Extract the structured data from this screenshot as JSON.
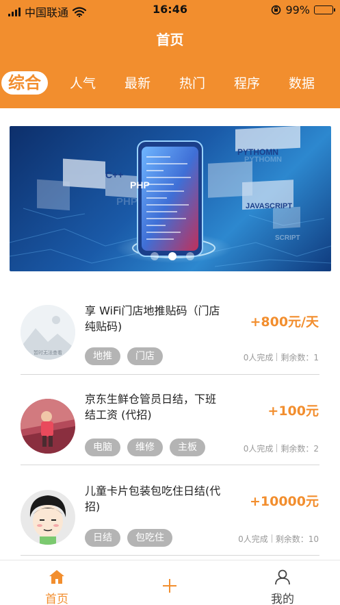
{
  "status_bar": {
    "carrier": "中国联通",
    "time": "16:46",
    "battery_text": "99%",
    "battery_level": 0.99,
    "icons": [
      "signal-icon",
      "wifi-icon",
      "orientation-lock-icon",
      "battery-icon"
    ]
  },
  "header": {
    "title": "首页",
    "color": "#f28e2e"
  },
  "tabs": [
    {
      "label": "综合",
      "active": true
    },
    {
      "label": "人气",
      "active": false
    },
    {
      "label": "最新",
      "active": false
    },
    {
      "label": "热门",
      "active": false
    },
    {
      "label": "程序",
      "active": false
    },
    {
      "label": "数据",
      "active": false
    }
  ],
  "banner": {
    "texts": [
      "PYTHOMN",
      "PYTHOMN",
      "C++",
      "PHP",
      "PHP",
      "JAVASCRIPT",
      "SCRIPT"
    ],
    "dots_total": 3,
    "active_dot": 1
  },
  "listings": [
    {
      "title": "享 WiFi门店地推贴码（门店纯贴码)",
      "price": "+800元/天",
      "tags": [
        "地推",
        "门店"
      ],
      "completed": "0人完成",
      "remaining": "剩余数：1",
      "image": "placeholder-image",
      "image_caption": "暂时无法查看"
    },
    {
      "title": "京东生鲜仓管员日结，下班结工资 (代招)",
      "price": "+100元",
      "tags": [
        "电脑",
        "维修",
        "主板"
      ],
      "completed": "0人完成",
      "remaining": "剩余数：2",
      "image": "person-photo"
    },
    {
      "title": "儿童卡片包装包吃住日结(代招)",
      "price": "+10000元",
      "tags": [
        "日结",
        "包吃住"
      ],
      "completed": "0人完成",
      "remaining": "剩余数：10",
      "image": "cartoon-avatar"
    }
  ],
  "tabbar": [
    {
      "label": "首页",
      "icon": "home-icon",
      "active": true
    },
    {
      "label": "",
      "icon": "plus-icon",
      "active": false
    },
    {
      "label": "我的",
      "icon": "user-icon",
      "active": false
    }
  ],
  "colors": {
    "accent": "#f28e2e",
    "tag_bg": "#b4b4b4",
    "muted": "#999999"
  }
}
